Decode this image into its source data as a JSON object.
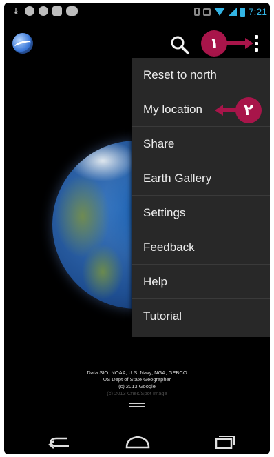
{
  "status_bar": {
    "time": "7:21",
    "left_icons": [
      "download-icon",
      "chat-icon",
      "check-icon",
      "image-icon",
      "gamepad-icon"
    ],
    "right_icons": [
      "vibrate-icon",
      "rotation-icon",
      "wifi-icon",
      "signal-icon",
      "battery-icon"
    ]
  },
  "action_bar": {
    "logo_icon": "google-earth-logo",
    "search_icon": "search-icon",
    "overflow_icon": "overflow-menu-icon"
  },
  "callouts": {
    "first": "۱",
    "second": "۲",
    "color": "#a8154a"
  },
  "menu": {
    "items": [
      {
        "label": "Reset to north"
      },
      {
        "label": "My location"
      },
      {
        "label": "Share"
      },
      {
        "label": "Earth Gallery"
      },
      {
        "label": "Settings"
      },
      {
        "label": "Feedback"
      },
      {
        "label": "Help"
      },
      {
        "label": "Tutorial"
      }
    ]
  },
  "attribution": {
    "line1": "Data SIO, NOAA, U.S. Navy, NGA, GEBCO",
    "line2": "US Dept of State Geographer",
    "line3": "(c) 2013 Google",
    "line4": "(c) 2013 Cnes/Spot Image"
  },
  "nav_bar": {
    "buttons": [
      "back-icon",
      "home-icon",
      "recent-apps-icon"
    ]
  },
  "colors": {
    "accent": "#33b5e5",
    "menu_background": "#282828",
    "screen_background": "#000000"
  }
}
